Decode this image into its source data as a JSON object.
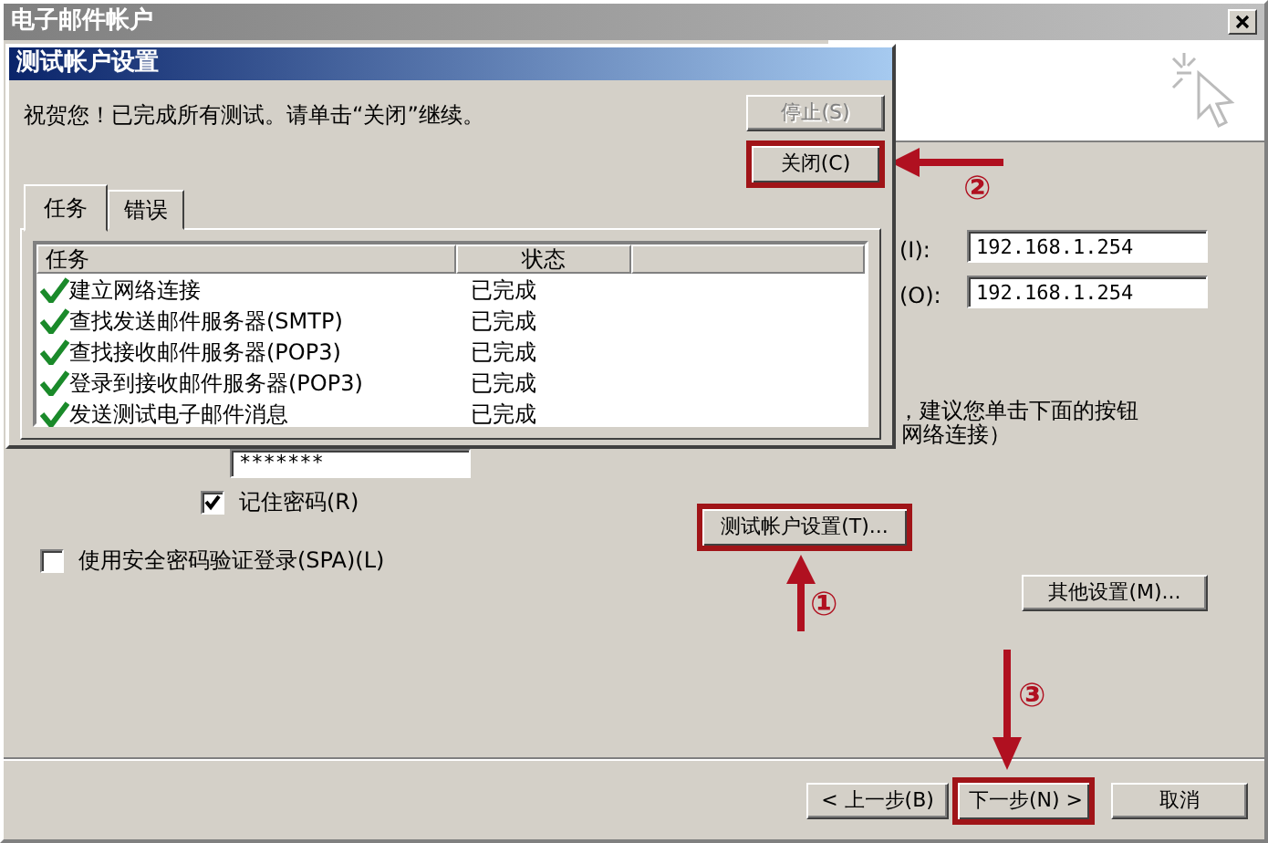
{
  "window": {
    "title": "电子邮件帐户"
  },
  "background_form": {
    "fields": [
      {
        "label": "(I):",
        "value": "192.168.1.254"
      },
      {
        "label": "(O):",
        "value": "192.168.1.254"
      }
    ],
    "hint_lines": [
      "，建议您单击下面的按钮",
      "网络连接）"
    ],
    "password": {
      "value": "*******"
    },
    "checkboxes": [
      {
        "label": "记住密码(R)",
        "checked": true
      },
      {
        "label": "使用安全密码验证登录(SPA)(L)",
        "checked": false
      }
    ],
    "test_button": {
      "label": "测试帐户设置(T)...",
      "highlighted": true
    },
    "more_button": {
      "label": "其他设置(M)...",
      "highlighted": false
    }
  },
  "nav_buttons": [
    {
      "label": "< 上一步(B)",
      "highlighted": false
    },
    {
      "label": "下一步(N) >",
      "highlighted": true
    },
    {
      "label": "取消",
      "highlighted": false
    }
  ],
  "dialog": {
    "title": "测试帐户设置",
    "message": "祝贺您！已完成所有测试。请单击“关闭”继续。",
    "buttons": [
      {
        "label": "停止(S)",
        "disabled": true,
        "highlighted": false
      },
      {
        "label": "关闭(C)",
        "disabled": false,
        "highlighted": true
      }
    ],
    "tabs": [
      {
        "label": "任务",
        "selected": true
      },
      {
        "label": "错误",
        "selected": false
      }
    ],
    "columns": [
      "任务",
      "状态"
    ],
    "rows": [
      {
        "task": "建立网络连接",
        "status": "已完成",
        "done": true
      },
      {
        "task": "查找发送邮件服务器(SMTP)",
        "status": "已完成",
        "done": true
      },
      {
        "task": "查找接收邮件服务器(POP3)",
        "status": "已完成",
        "done": true
      },
      {
        "task": "登录到接收邮件服务器(POP3)",
        "status": "已完成",
        "done": true
      },
      {
        "task": "发送测试电子邮件消息",
        "status": "已完成",
        "done": true
      }
    ]
  },
  "annotations": [
    {
      "label": "①",
      "kind": "up"
    },
    {
      "label": "②",
      "kind": "left"
    },
    {
      "label": "③",
      "kind": "down"
    }
  ]
}
